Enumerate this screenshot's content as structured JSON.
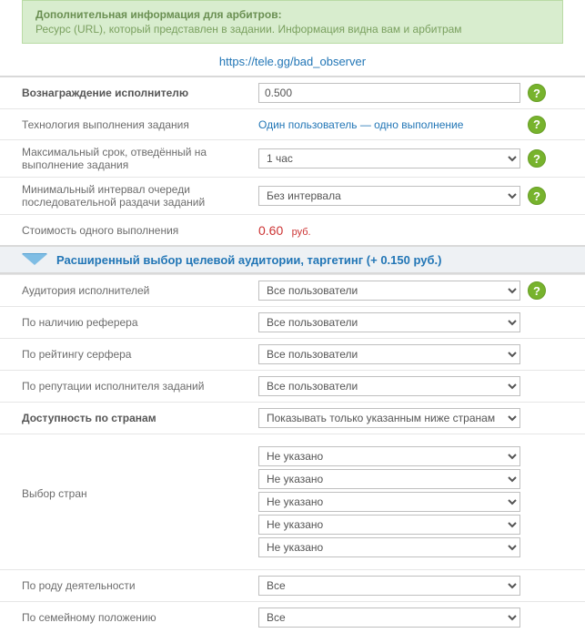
{
  "info": {
    "title": "Дополнительная информация для арбитров:",
    "text": "Ресурс (URL), который представлен в задании. Информация видна вам и арбитрам"
  },
  "url": "https://tele.gg/bad_observer",
  "rows": {
    "reward": {
      "label": "Вознаграждение исполнителю",
      "value": "0.500"
    },
    "tech": {
      "label": "Технология выполнения задания",
      "value": "Один пользователь — одно выполнение"
    },
    "maxtime": {
      "label": "Максимальный срок, отведённый на выполнение задания",
      "value": "1 час"
    },
    "mininterval": {
      "label": "Минимальный интервал очереди последовательной раздачи заданий",
      "value": "Без интервала"
    },
    "cost": {
      "label": "Стоимость одного выполнения",
      "value": "0.60",
      "unit": "руб."
    }
  },
  "targeting": {
    "header": "Расширенный выбор целевой аудитории, таргетинг (+ 0.150 руб.)",
    "audience": {
      "label": "Аудитория исполнителей",
      "value": "Все пользователи"
    },
    "referer": {
      "label": "По наличию реферера",
      "value": "Все пользователи"
    },
    "rating": {
      "label": "По рейтингу серфера",
      "value": "Все пользователи"
    },
    "reputation": {
      "label": "По репутации исполнителя заданий",
      "value": "Все пользователи"
    },
    "countries_avail": {
      "label": "Доступность по странам",
      "value": "Показывать только указанным ниже странам"
    },
    "country_pick": {
      "label": "Выбор стран",
      "values": [
        "Не указано",
        "Не указано",
        "Не указано",
        "Не указано",
        "Не указано"
      ]
    },
    "occupation": {
      "label": "По роду деятельности",
      "value": "Все"
    },
    "marital": {
      "label": "По семейному положению",
      "value": "Все"
    }
  },
  "help_glyph": "?"
}
